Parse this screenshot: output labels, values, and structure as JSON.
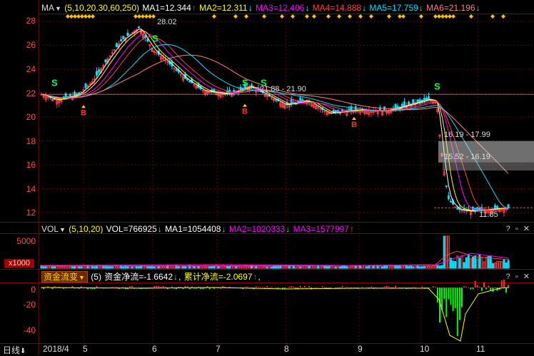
{
  "main_panel": {
    "indicator": "MA",
    "params": "(5,10,20,30,60,250)",
    "ma1": "MA1=12.344",
    "ma1_arrow": "↑",
    "ma2": "MA2=12.311",
    "ma2_arrow": "↓",
    "ma3": "MA3=12.406",
    "ma3_arrow": "↓",
    "ma4": "MA4=14.888",
    "ma4_arrow": "↓",
    "ma5": "MA5=17.759",
    "ma5_arrow": "↓",
    "ma6": "MA6=21.196",
    "ma6_arrow": "↓",
    "y_ticks": [
      "28",
      "26",
      "24",
      "22",
      "20",
      "18",
      "16",
      "14",
      "12"
    ],
    "annotations": {
      "high": "28.02",
      "range1": "21.88 - 21.90",
      "range2": "16.19 - 17.99",
      "range3": "15.52 - 16.19",
      "low": "11.85"
    },
    "signals": {
      "sell": "S",
      "buy": "B"
    }
  },
  "vol_panel": {
    "indicator": "VOL",
    "params": "(5,10,20)",
    "vol": "VOL=766925",
    "vol_arrow": "↓",
    "ma1": "MA1=1054408",
    "ma1_arrow": "↓",
    "ma2": "MA2=1020333",
    "ma2_arrow": "↓",
    "ma3": "MA3=1577997",
    "ma3_arrow": "↑",
    "y_ticks": [
      "5000"
    ],
    "unit": "x1000"
  },
  "fund_panel": {
    "indicator": "资金流变",
    "params": "(5)",
    "net": "资金净流=-1.6642",
    "net_arrow": "↓",
    "cum": "累计净流=-2.0697",
    "cum_arrow": "↑",
    "sep": ",",
    "y_ticks": [
      "0",
      "-20",
      "-40"
    ]
  },
  "footer": {
    "period": "日线",
    "period_arrow": "⬇",
    "x_labels": [
      "2018/4",
      "5",
      "6",
      "7",
      "8",
      "9",
      "10",
      "11"
    ]
  },
  "controls": {
    "panel": "? ▫ ✕"
  },
  "colors": {
    "up": "#ff3b3b",
    "down": "#00e0ff",
    "ma1": "#ffffff",
    "ma2": "#ffff00",
    "ma3": "#ff00ff",
    "ma4": "#ff4040",
    "ma5": "#00e0ff",
    "ma6": "#ff8080",
    "fund_in": "#ff3030",
    "fund_out": "#00ff00",
    "cum": "#ffff00",
    "signal_sell": "#00ff40",
    "signal_buy": "#ff3030"
  }
}
